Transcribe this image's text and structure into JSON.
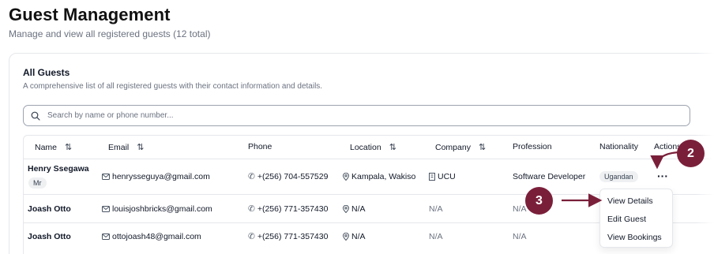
{
  "page": {
    "title": "Guest Management",
    "subtitle": "Manage and view all registered guests (12 total)"
  },
  "card": {
    "title": "All Guests",
    "description": "A comprehensive list of all registered guests with their contact information and details."
  },
  "search": {
    "placeholder": "Search by name or phone number...",
    "icon": "search-icon"
  },
  "table": {
    "headers": {
      "name": "Name",
      "email": "Email",
      "phone": "Phone",
      "location": "Location",
      "company": "Company",
      "profession": "Profession",
      "nationality": "Nationality",
      "actions": "Actions"
    },
    "rows": [
      {
        "name": "Henry Ssegawa",
        "title_badge": "Mr",
        "email": "henrysseguya@gmail.com",
        "phone": "+(256) 704-557529",
        "location": "Kampala, Wakiso",
        "company": "UCU",
        "profession": "Software Developer",
        "nationality": "Ugandan"
      },
      {
        "name": "Joash Otto",
        "email": "louisjoshbricks@gmail.com",
        "phone": "+(256) 771-357430",
        "location": "N/A",
        "company": "N/A",
        "profession": "N/A"
      },
      {
        "name": "Joash Otto",
        "email": "ottojoash48@gmail.com",
        "phone": "+(256) 771-357430",
        "location": "N/A",
        "company": "N/A",
        "profession": "N/A"
      }
    ]
  },
  "actions_menu": {
    "trigger": "···",
    "items": [
      "View Details",
      "Edit Guest",
      "View Bookings"
    ]
  },
  "annotations": {
    "step2": "2",
    "step3": "3"
  },
  "colors": {
    "annotation": "#7a1f3a",
    "border": "#e5e7eb",
    "muted_text": "#6b7280"
  }
}
